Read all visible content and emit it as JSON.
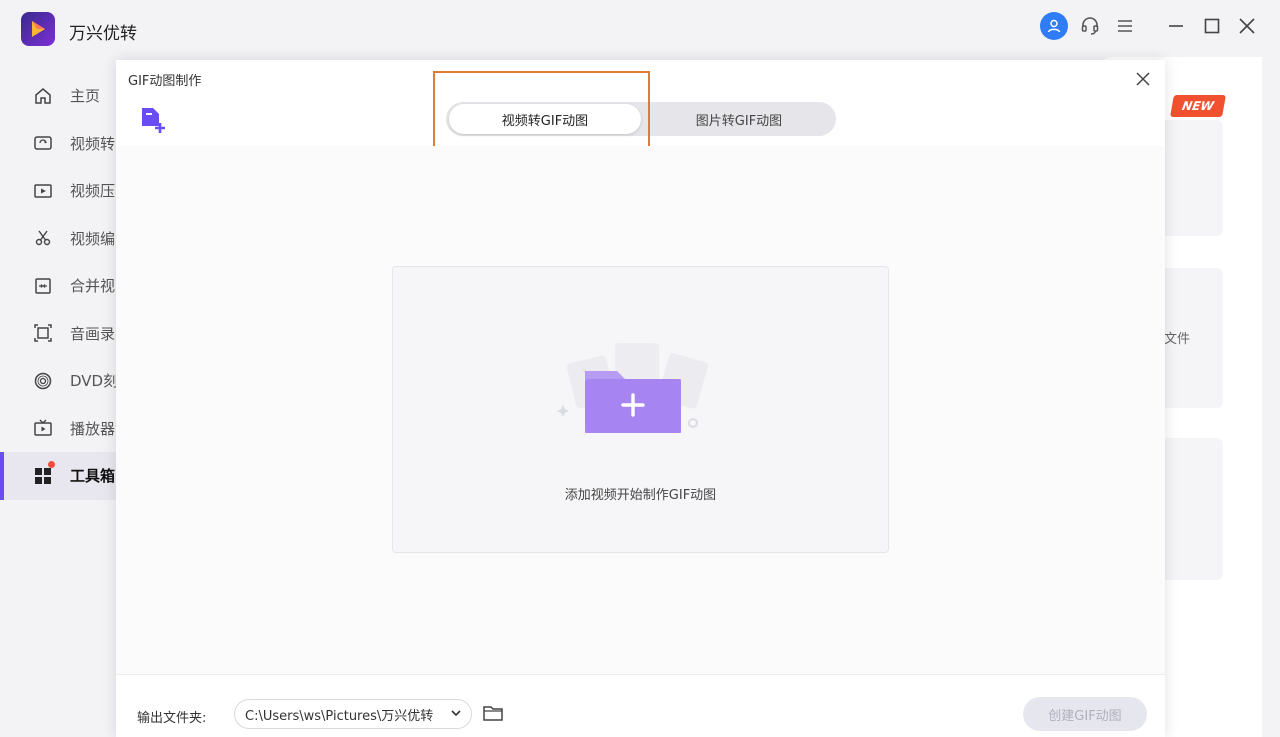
{
  "app": {
    "name": "万兴优转",
    "logo_icon": "play-triangle-logo",
    "accent": "#6a4cf5"
  },
  "window_controls": [
    "avatar-icon",
    "headset-icon",
    "menu-icon",
    "minimize-icon",
    "maximize-icon",
    "close-icon"
  ],
  "sidebar": {
    "items": [
      {
        "label": "主页",
        "icon": "home-icon"
      },
      {
        "label": "视频转",
        "icon": "video-convert-icon"
      },
      {
        "label": "视频压",
        "icon": "video-compress-icon"
      },
      {
        "label": "视频编",
        "icon": "scissors-icon"
      },
      {
        "label": "合并视",
        "icon": "merge-icon"
      },
      {
        "label": "音画录",
        "icon": "screen-record-icon"
      },
      {
        "label": "DVD刻",
        "icon": "dvd-icon"
      },
      {
        "label": "播放器",
        "icon": "player-icon"
      },
      {
        "label": "工具箱",
        "icon": "toolbox-icon",
        "active": true
      }
    ]
  },
  "background": {
    "new_badge": "NEW",
    "partial_text": "文件"
  },
  "dialog": {
    "title": "GIF动图制作",
    "tabs": [
      "视频转GIF动图",
      "图片转GIF动图"
    ],
    "active_tab": 0,
    "dropzone_text": "添加视频开始制作GIF动图",
    "output_label": "输出文件夹:",
    "output_path": "C:\\Users\\ws\\Pictures\\万兴优转",
    "create_button": "创建GIF动图"
  }
}
